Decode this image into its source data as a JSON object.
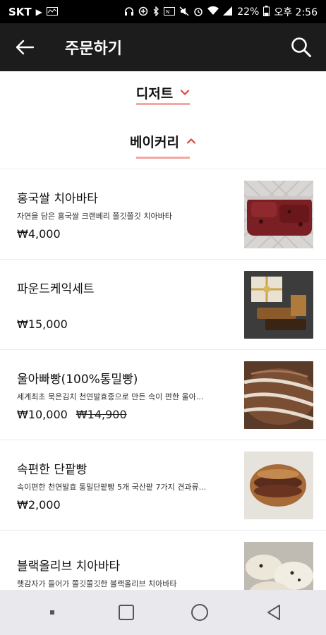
{
  "status_bar": {
    "carrier": "SKT",
    "battery": "22%",
    "time": "오후 2:56"
  },
  "app_bar": {
    "title": "주문하기"
  },
  "categories": [
    {
      "label": "디저트",
      "expanded": false
    },
    {
      "label": "베이커리",
      "expanded": true
    }
  ],
  "products": [
    {
      "name": "홍국쌀 치아바타",
      "description": "자연을 담은 홍국쌀 크랜베리 쫄깃쫄깃 치아바타",
      "price": "₩4,000",
      "original_price": ""
    },
    {
      "name": "파운드케익세트",
      "description": "",
      "price": "₩15,000",
      "original_price": ""
    },
    {
      "name": "울아빠빵(100%통밀빵)",
      "description": "세계최초 묵은김치 천연발효종으로 만든 속이 편한 울아...",
      "price": "₩10,000",
      "original_price": "₩14,900"
    },
    {
      "name": "속편한 단팥빵",
      "description": "속이편한 천연발효 통밀단팥빵 5개 국산팥 7가지 견과류...",
      "price": "₩2,000",
      "original_price": ""
    },
    {
      "name": "블랙올리브 치아바타",
      "description": "햇감자가 들어가 쫄깃쫄깃한 블랙올리브 치아바타",
      "price": "",
      "original_price": ""
    }
  ],
  "colors": {
    "accent": "#e0453f",
    "underline": "#f3a6a3",
    "app_bar": "#1c1c1c",
    "nav_bar": "#e9e9ed"
  }
}
